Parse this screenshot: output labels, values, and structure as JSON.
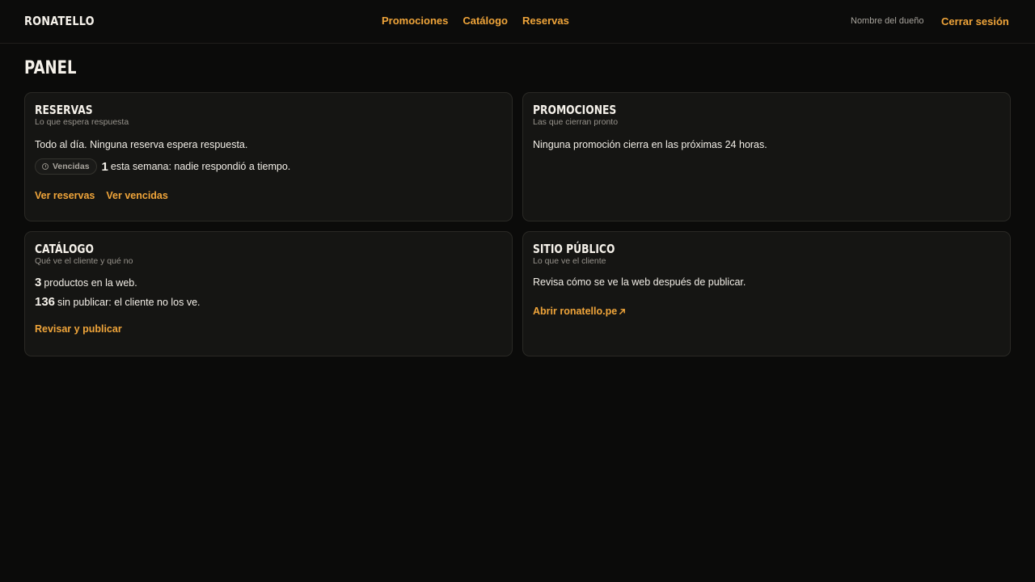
{
  "header": {
    "brand": "RONATELLO",
    "nav": [
      "Promociones",
      "Catálogo",
      "Reservas"
    ],
    "owner": "Nombre del dueño",
    "logout": "Cerrar sesión"
  },
  "page": {
    "title": "PANEL"
  },
  "reservas": {
    "title": "RESERVAS",
    "subtitle": "Lo que espera respuesta",
    "status": "Todo al día. Ninguna reserva espera respuesta.",
    "badge": "Vencidas",
    "overdue_count": "1",
    "overdue_text": "esta semana: nadie respondió a tiempo.",
    "link_view": "Ver reservas",
    "link_overdue": "Ver vencidas"
  },
  "promociones": {
    "title": "PROMOCIONES",
    "subtitle": "Las que cierran pronto",
    "status": "Ninguna promoción cierra en las próximas 24 horas."
  },
  "catalogo": {
    "title": "CATÁLOGO",
    "subtitle": "Qué ve el cliente y qué no",
    "published_count": "3",
    "published_text": "productos en la web.",
    "unpublished_count": "136",
    "unpublished_text": "sin publicar: el cliente no los ve.",
    "link_review": "Revisar y publicar"
  },
  "sitio": {
    "title": "SITIO PÚBLICO",
    "subtitle": "Lo que ve el cliente",
    "text": "Revisa cómo se ve la web después de publicar.",
    "link": "Abrir ronatello.pe"
  },
  "colors": {
    "accent": "#f0a53a",
    "background": "#0b0b0a",
    "card": "#151513"
  }
}
